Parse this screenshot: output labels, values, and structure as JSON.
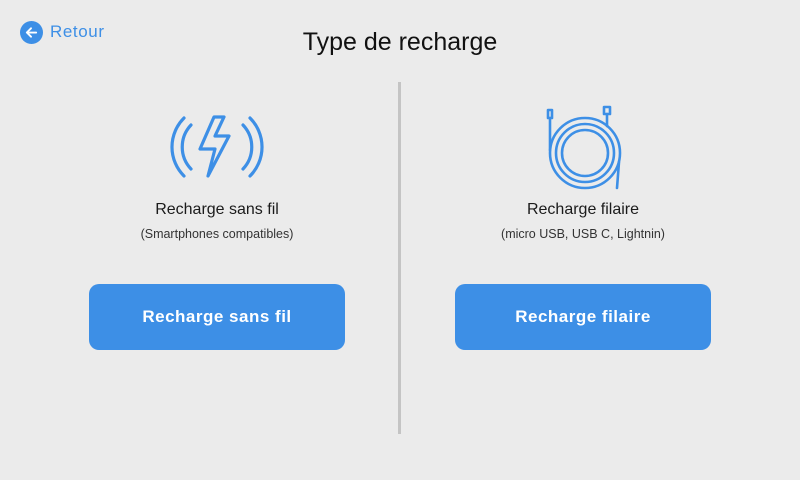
{
  "back": {
    "label": "Retour",
    "icon": "arrow-left-icon"
  },
  "header": {
    "title": "Type de recharge"
  },
  "options": [
    {
      "icon": "wireless-charging-icon",
      "title": "Recharge sans fil",
      "subtitle": "(Smartphones compatibles)",
      "button_label": "Recharge sans fil"
    },
    {
      "icon": "cable-icon",
      "title": "Recharge filaire",
      "subtitle": "(micro USB, USB C, Lightnin)",
      "button_label": "Recharge filaire"
    }
  ],
  "colors": {
    "accent": "#3d8fe6",
    "background": "#ebebeb",
    "divider": "#c4c4c4",
    "text": "#1b1b1b"
  }
}
